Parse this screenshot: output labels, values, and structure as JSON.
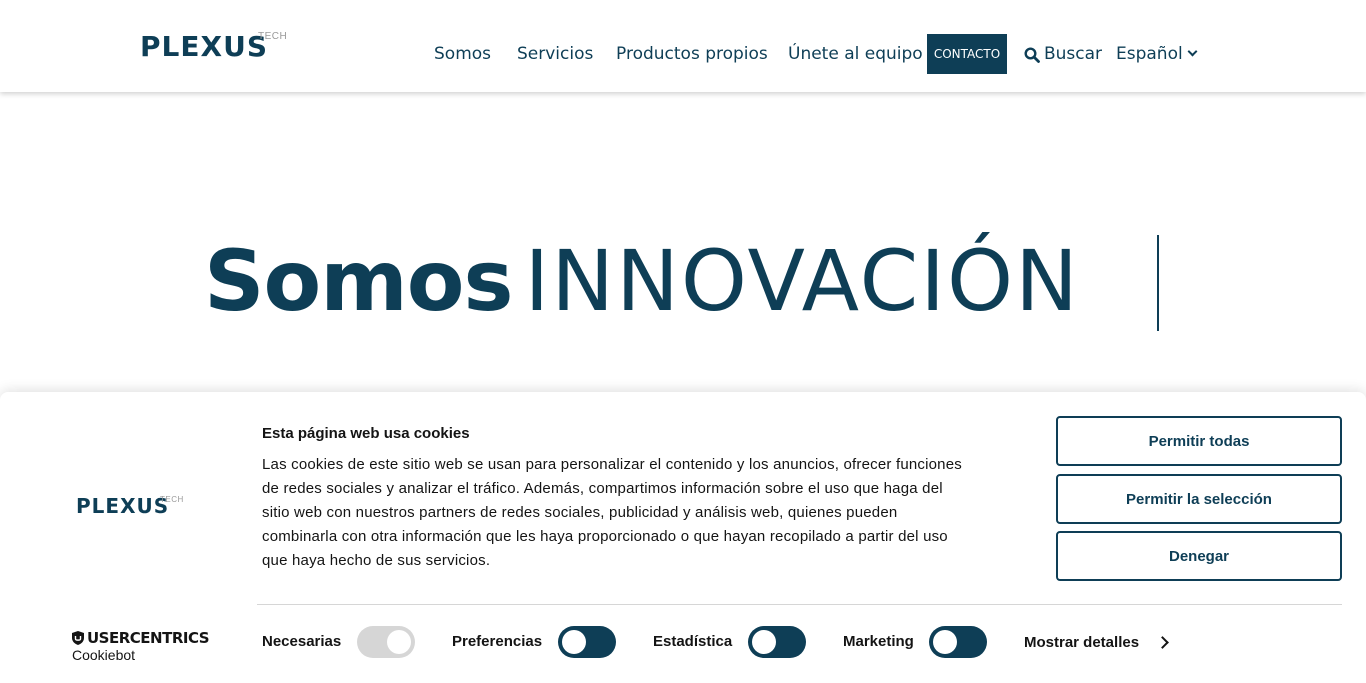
{
  "header": {
    "logo_text": "PLEXUS",
    "logo_sub": "TECH",
    "nav": [
      "Somos",
      "Servicios",
      "Productos propios",
      "Únete al equipo"
    ],
    "contact_label": "CONTACTO",
    "search_label": "Buscar",
    "language_label": "Español"
  },
  "hero": {
    "bold": "Somos",
    "light": "INNOVACIÓN"
  },
  "cookie": {
    "logo_text": "PLEXUS",
    "logo_sub": "TECH",
    "title": "Esta página web usa cookies",
    "body_lines": [
      "Las cookies de este sitio web se usan para personalizar el contenido y los anuncios, ofrecer funciones",
      "de redes sociales y analizar el tráfico. Además, compartimos información sobre el uso que haga del",
      "sitio web con nuestros partners de redes sociales, publicidad y análisis web, quienes pueden",
      "combinarla con otra información que les haya proporcionado o que hayan recopilado a partir del uso",
      "que haya hecho de sus servicios."
    ],
    "buttons": {
      "allow_all": "Permitir todas",
      "allow_selection": "Permitir la selección",
      "deny": "Denegar"
    },
    "brand_name": "USERCENTRICS",
    "brand_sub": "Cookiebot",
    "toggles": [
      {
        "label": "Necesarias",
        "state": "on",
        "disabled": true
      },
      {
        "label": "Preferencias",
        "state": "off",
        "disabled": false
      },
      {
        "label": "Estadística",
        "state": "off",
        "disabled": false
      },
      {
        "label": "Marketing",
        "state": "off",
        "disabled": false
      }
    ],
    "details_label": "Mostrar detalles"
  },
  "colors": {
    "brand_navy": "#0e3e56",
    "brand_red": "#d9323a",
    "toggle_disabled": "#d6d6d6"
  }
}
